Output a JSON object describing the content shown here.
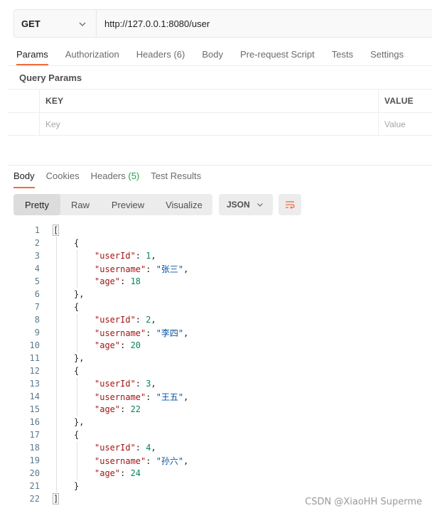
{
  "request": {
    "method": "GET",
    "url": "http://127.0.0.1:8080/user"
  },
  "request_tabs": [
    {
      "label": "Params",
      "count": ""
    },
    {
      "label": "Authorization",
      "count": ""
    },
    {
      "label": "Headers",
      "count": "(6)"
    },
    {
      "label": "Body",
      "count": ""
    },
    {
      "label": "Pre-request Script",
      "count": ""
    },
    {
      "label": "Tests",
      "count": ""
    },
    {
      "label": "Settings",
      "count": ""
    }
  ],
  "query_params": {
    "title": "Query Params",
    "key_header": "KEY",
    "value_header": "VALUE",
    "key_placeholder": "Key",
    "value_placeholder": "Value"
  },
  "response_tabs": [
    {
      "label": "Body",
      "count": ""
    },
    {
      "label": "Cookies",
      "count": ""
    },
    {
      "label": "Headers",
      "count": "(5)"
    },
    {
      "label": "Test Results",
      "count": ""
    }
  ],
  "view_modes": [
    "Pretty",
    "Raw",
    "Preview",
    "Visualize"
  ],
  "format": "JSON",
  "response_body": {
    "line_numbers": [
      "1",
      "2",
      "3",
      "4",
      "5",
      "6",
      "7",
      "8",
      "9",
      "10",
      "11",
      "12",
      "13",
      "14",
      "15",
      "16",
      "17",
      "18",
      "19",
      "20",
      "21",
      "22"
    ],
    "users": [
      {
        "userId_key": "\"userId\"",
        "userId": "1",
        "username_key": "\"username\"",
        "username": "\"张三\"",
        "age_key": "\"age\"",
        "age": "18"
      },
      {
        "userId_key": "\"userId\"",
        "userId": "2",
        "username_key": "\"username\"",
        "username": "\"李四\"",
        "age_key": "\"age\"",
        "age": "20"
      },
      {
        "userId_key": "\"userId\"",
        "userId": "3",
        "username_key": "\"username\"",
        "username": "\"王五\"",
        "age_key": "\"age\"",
        "age": "22"
      },
      {
        "userId_key": "\"userId\"",
        "userId": "4",
        "username_key": "\"username\"",
        "username": "\"孙六\"",
        "age_key": "\"age\"",
        "age": "24"
      }
    ]
  },
  "watermark": "CSDN @XiaoHH Superme",
  "colors": {
    "accent": "#f26b3a",
    "json_key": "#a31515",
    "json_string": "#0451a5",
    "json_number": "#098658",
    "count_green": "#2a9d4a"
  }
}
